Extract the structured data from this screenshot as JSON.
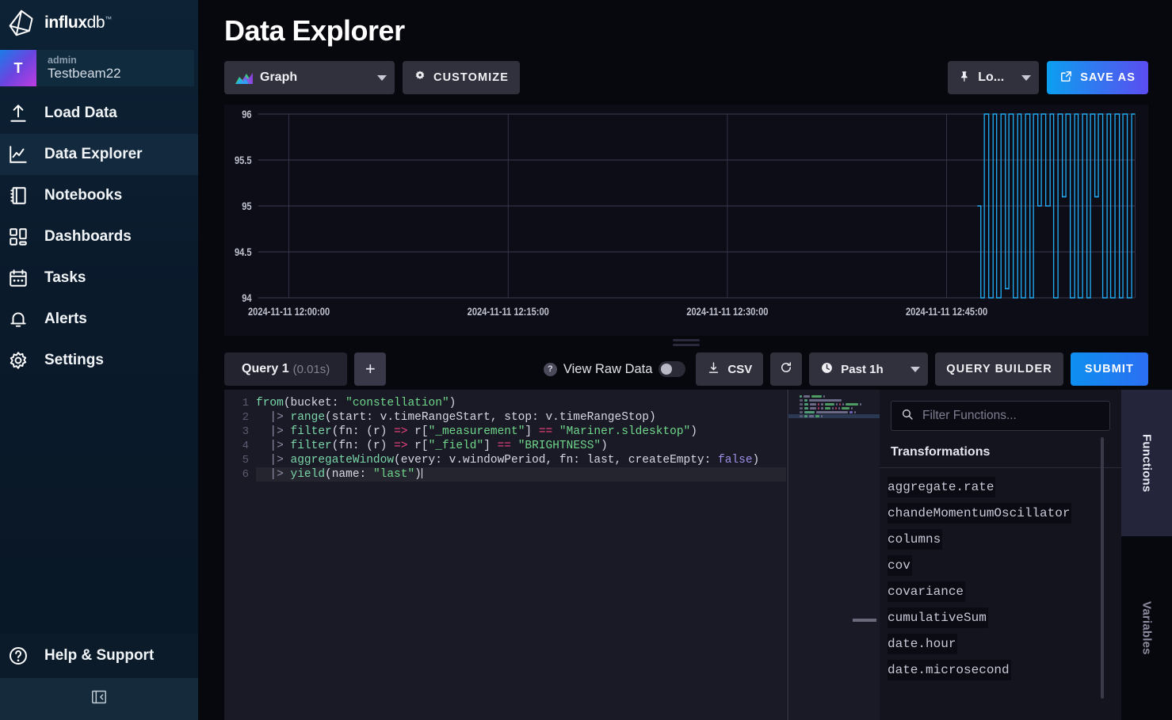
{
  "brand": {
    "name_bold": "influx",
    "name_light": "db",
    "tm": "™",
    "logo_icon": "influxdb-cube-logo"
  },
  "account": {
    "initial": "T",
    "role": "admin",
    "org": "Testbeam22"
  },
  "sidebar": {
    "items": [
      {
        "label": "Load Data",
        "icon": "upload-icon",
        "active": false
      },
      {
        "label": "Data Explorer",
        "icon": "line-chart-icon",
        "active": true
      },
      {
        "label": "Notebooks",
        "icon": "notebook-icon",
        "active": false
      },
      {
        "label": "Dashboards",
        "icon": "dashboard-icon",
        "active": false
      },
      {
        "label": "Tasks",
        "icon": "calendar-icon",
        "active": false
      },
      {
        "label": "Alerts",
        "icon": "bell-icon",
        "active": false
      },
      {
        "label": "Settings",
        "icon": "gear-icon",
        "active": false
      }
    ],
    "help": {
      "label": "Help & Support",
      "icon": "question-circle-icon"
    },
    "collapse": {
      "icon": "collapse-panel-icon"
    }
  },
  "header": {
    "title": "Data Explorer"
  },
  "viz_toolbar": {
    "graph_type": "Graph",
    "customize_label": "CUSTOMIZE",
    "local_label": "Lo...",
    "save_as_label": "SAVE AS",
    "icons": {
      "graph": "area-chart-icon",
      "customize": "gear-icon",
      "local": "pin-icon",
      "save": "external-link-icon"
    }
  },
  "query_toolbar": {
    "tab_label": "Query 1",
    "tab_duration": "(0.01s)",
    "add_label": "+",
    "view_raw_label": "View Raw Data",
    "view_raw_on": false,
    "help_icon": "question-mark-icon",
    "csv_label": "CSV",
    "csv_icon": "download-icon",
    "refresh_icon": "refresh-icon",
    "time_range": "Past 1h",
    "time_icon": "clock-icon",
    "query_builder_label": "QUERY BUILDER",
    "submit_label": "SUBMIT"
  },
  "editor": {
    "line_numbers": [
      "1",
      "2",
      "3",
      "4",
      "5",
      "6"
    ],
    "active_line": 6,
    "lines": [
      [
        {
          "t": "from",
          "c": "fn"
        },
        {
          "t": "(bucket: ",
          "c": "pnorm"
        },
        {
          "t": "\"constellation\"",
          "c": "str"
        },
        {
          "t": ")",
          "c": "pnorm"
        }
      ],
      [
        {
          "t": "  |> ",
          "c": "pipe"
        },
        {
          "t": "range",
          "c": "fn"
        },
        {
          "t": "(start: v.timeRangeStart, stop: v.timeRangeStop)",
          "c": "pnorm"
        }
      ],
      [
        {
          "t": "  |> ",
          "c": "pipe"
        },
        {
          "t": "filter",
          "c": "fn"
        },
        {
          "t": "(fn: (r) ",
          "c": "pnorm"
        },
        {
          "t": "=>",
          "c": "op"
        },
        {
          "t": " r[",
          "c": "pnorm"
        },
        {
          "t": "\"_measurement\"",
          "c": "str"
        },
        {
          "t": "] ",
          "c": "pnorm"
        },
        {
          "t": "==",
          "c": "op"
        },
        {
          "t": " ",
          "c": "pnorm"
        },
        {
          "t": "\"Mariner.sldesktop\"",
          "c": "str"
        },
        {
          "t": ")",
          "c": "pnorm"
        }
      ],
      [
        {
          "t": "  |> ",
          "c": "pipe"
        },
        {
          "t": "filter",
          "c": "fn"
        },
        {
          "t": "(fn: (r) ",
          "c": "pnorm"
        },
        {
          "t": "=>",
          "c": "op"
        },
        {
          "t": " r[",
          "c": "pnorm"
        },
        {
          "t": "\"_field\"",
          "c": "str"
        },
        {
          "t": "] ",
          "c": "pnorm"
        },
        {
          "t": "==",
          "c": "op"
        },
        {
          "t": " ",
          "c": "pnorm"
        },
        {
          "t": "\"BRIGHTNESS\"",
          "c": "str"
        },
        {
          "t": ")",
          "c": "pnorm"
        }
      ],
      [
        {
          "t": "  |> ",
          "c": "pipe"
        },
        {
          "t": "aggregateWindow",
          "c": "fn"
        },
        {
          "t": "(every: v.windowPeriod, fn: last, createEmpty: ",
          "c": "pnorm"
        },
        {
          "t": "false",
          "c": "kw"
        },
        {
          "t": ")",
          "c": "pnorm"
        }
      ],
      [
        {
          "t": "  |> ",
          "c": "pipe"
        },
        {
          "t": "yield",
          "c": "fn"
        },
        {
          "t": "(name: ",
          "c": "pnorm"
        },
        {
          "t": "\"last\"",
          "c": "str"
        },
        {
          "t": ")",
          "c": "pnorm"
        }
      ]
    ]
  },
  "functions_panel": {
    "search_placeholder": "Filter Functions...",
    "search_value": "",
    "search_icon": "search-icon",
    "section_title": "Transformations",
    "items": [
      "aggregate.rate",
      "chandeMomentumOscillator",
      "columns",
      "cov",
      "covariance",
      "cumulativeSum",
      "date.hour",
      "date.microsecond"
    ]
  },
  "side_tabs": {
    "functions": "Functions",
    "variables": "Variables",
    "active": "Functions"
  },
  "chart_data": {
    "type": "line",
    "title": "",
    "xlabel": "",
    "ylabel": "",
    "ylim": [
      94,
      96
    ],
    "yticks": [
      94,
      94.5,
      95,
      95.5,
      96
    ],
    "ytick_labels": [
      "94",
      "94.5",
      "95",
      "95.5",
      "96"
    ],
    "xtick_labels": [
      "2024-11-11 12:00:00",
      "2024-11-11 12:15:00",
      "2024-11-11 12:30:00",
      "2024-11-11 12:45:00"
    ],
    "grid": true,
    "legend": "none",
    "series": [
      {
        "name": "Mariner.sldesktop BRIGHTNESS",
        "color": "#22adf6",
        "note": "square-wave step line; data present only in final ~17% of the time axis (after ~12:49)",
        "x_frac": [
          0.82,
          0.824,
          0.824,
          0.828,
          0.828,
          0.833,
          0.833,
          0.838,
          0.838,
          0.842,
          0.842,
          0.847,
          0.847,
          0.852,
          0.852,
          0.856,
          0.856,
          0.861,
          0.861,
          0.866,
          0.866,
          0.87,
          0.87,
          0.875,
          0.875,
          0.88,
          0.88,
          0.884,
          0.884,
          0.889,
          0.889,
          0.893,
          0.893,
          0.898,
          0.898,
          0.903,
          0.903,
          0.907,
          0.907,
          0.912,
          0.912,
          0.917,
          0.917,
          0.921,
          0.921,
          0.926,
          0.926,
          0.931,
          0.931,
          0.935,
          0.935,
          0.94,
          0.94,
          0.945,
          0.945,
          0.949,
          0.949,
          0.954,
          0.954,
          0.958,
          0.958,
          0.963,
          0.963,
          0.968,
          0.968,
          0.972,
          0.972,
          0.977,
          0.977,
          0.982,
          0.982,
          0.986,
          0.986,
          0.991,
          0.991,
          0.996,
          0.996,
          1.0
        ],
        "values": [
          95.0,
          95.0,
          94.0,
          94.0,
          96.0,
          96.0,
          94.0,
          94.0,
          96.0,
          96.0,
          94.0,
          94.0,
          96.0,
          96.0,
          94.1,
          94.1,
          96.0,
          96.0,
          94.0,
          94.0,
          96.0,
          96.0,
          94.0,
          94.0,
          96.0,
          96.0,
          94.0,
          94.0,
          96.0,
          96.0,
          95.0,
          95.0,
          96.0,
          96.0,
          95.0,
          95.0,
          96.0,
          96.0,
          94.0,
          94.0,
          96.0,
          96.0,
          95.1,
          95.1,
          96.0,
          96.0,
          94.0,
          94.0,
          96.0,
          96.0,
          94.0,
          94.0,
          96.0,
          96.0,
          94.0,
          94.0,
          96.0,
          96.0,
          95.1,
          95.1,
          96.0,
          96.0,
          94.0,
          94.0,
          96.0,
          96.0,
          94.0,
          94.0,
          96.0,
          96.0,
          94.0,
          94.0,
          96.0,
          96.0,
          94.0,
          94.0,
          96.0,
          96.0
        ]
      }
    ]
  },
  "colors": {
    "accent_blue": "#22adf6",
    "brand_gradient_start": "#0b9ff0",
    "brand_gradient_end": "#5b4df0",
    "sidebar_bg": "#0a1a2b",
    "panel_bg": "#0d0d17",
    "editor_bg": "#1a1a26"
  }
}
